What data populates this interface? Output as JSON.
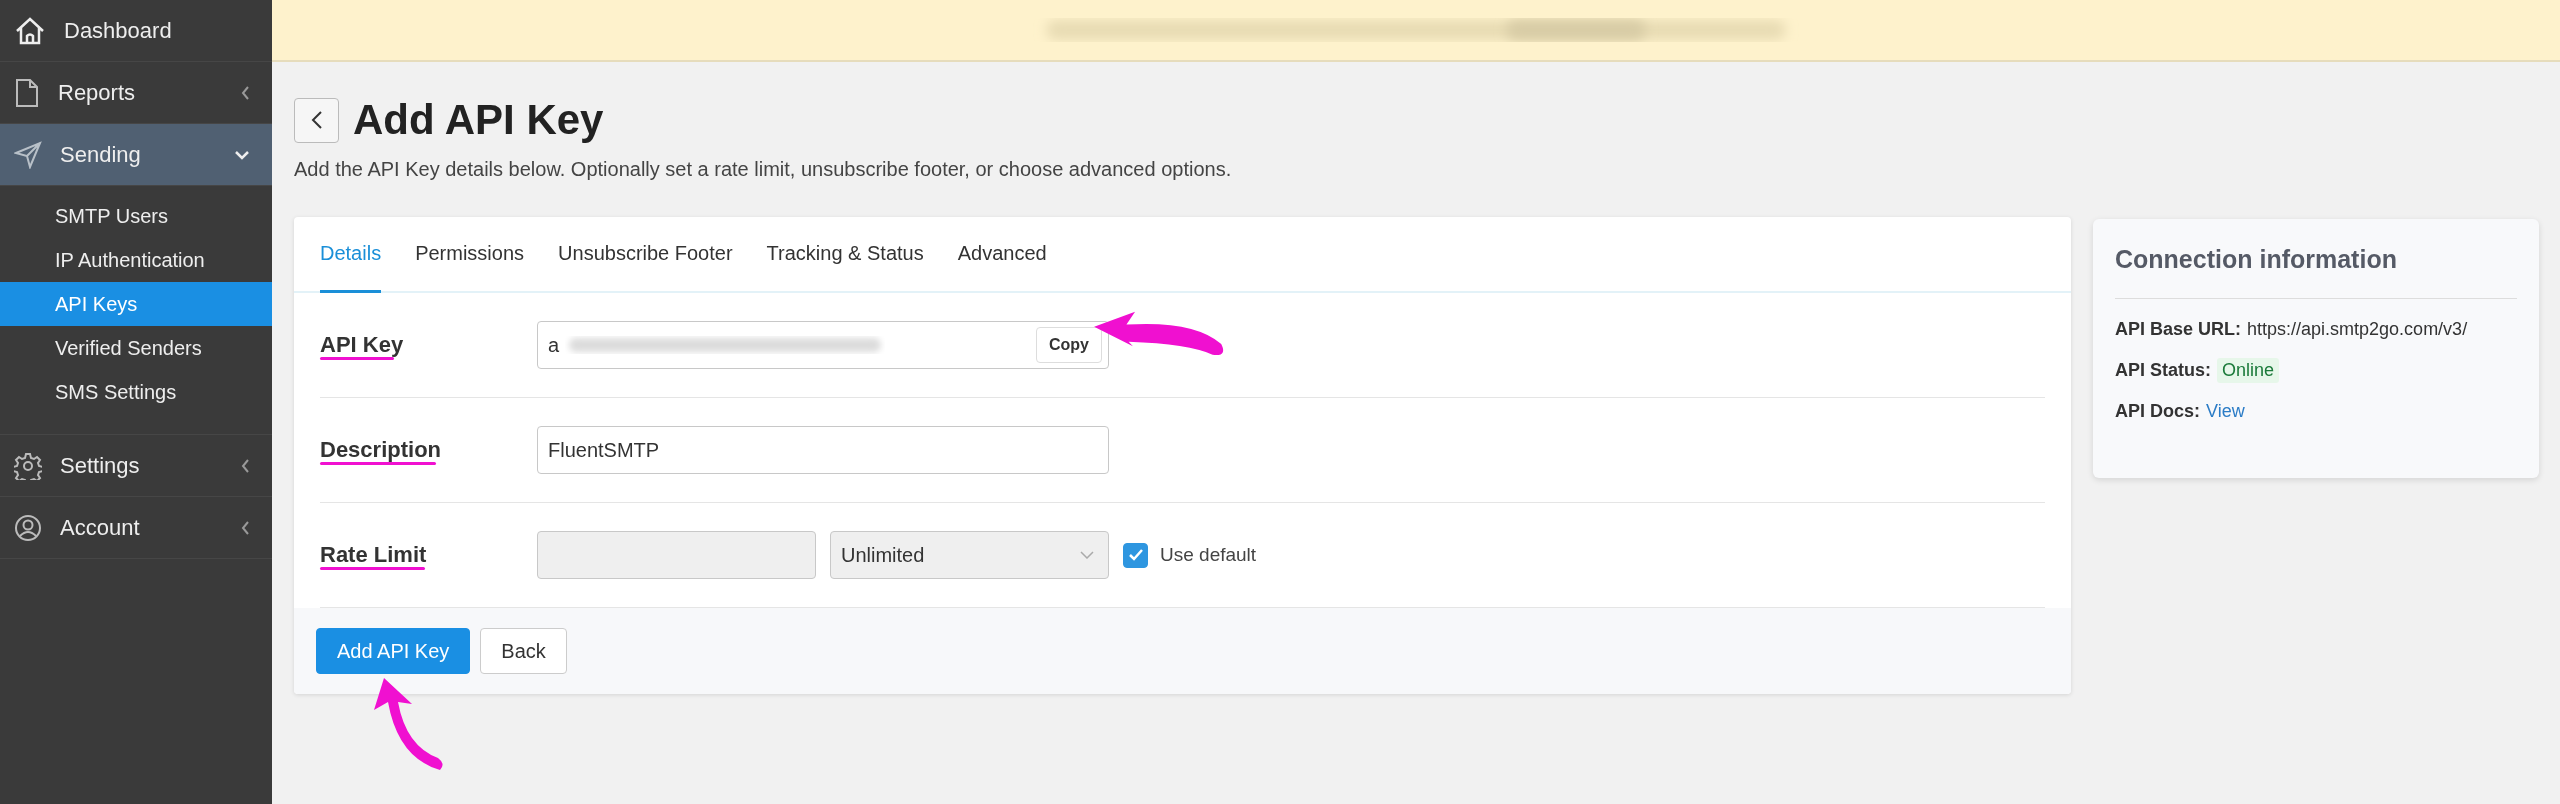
{
  "sidebar": {
    "items": [
      {
        "label": "Dashboard",
        "selected": false
      },
      {
        "label": "Reports",
        "expanded": false,
        "selected": false
      },
      {
        "label": "Sending",
        "expanded": true,
        "selected": true,
        "children": [
          {
            "label": "SMTP Users",
            "selected": false
          },
          {
            "label": "IP Authentication",
            "selected": false
          },
          {
            "label": "API Keys",
            "selected": true
          },
          {
            "label": "Verified Senders",
            "selected": false
          },
          {
            "label": "SMS Settings",
            "selected": false
          }
        ]
      },
      {
        "label": "Settings",
        "expanded": false,
        "selected": false
      },
      {
        "label": "Account",
        "expanded": false,
        "selected": false
      }
    ]
  },
  "banner": {
    "kind": "blurred"
  },
  "header": {
    "title": "Add API Key",
    "subtitle": "Add the API Key details below. Optionally set a rate limit, unsubscribe footer, or choose advanced options."
  },
  "tabs": [
    {
      "label": "Details",
      "selected": true
    },
    {
      "label": "Permissions",
      "selected": false
    },
    {
      "label": "Unsubscribe Footer",
      "selected": false
    },
    {
      "label": "Tracking & Status",
      "selected": false
    },
    {
      "label": "Advanced",
      "selected": false
    }
  ],
  "form": {
    "rows": [
      {
        "kind": "secret",
        "label": "API Key",
        "value": "a",
        "button": "Copy",
        "underlined": true,
        "pointed": true
      },
      {
        "kind": "text",
        "label": "Description",
        "value": "FluentSMTP",
        "underlined": true,
        "pointed": false
      },
      {
        "kind": "rate",
        "label": "Rate Limit",
        "value": "",
        "select": "Unlimited",
        "disabled": true,
        "checkbox": {
          "label": "Use default",
          "checked": true
        },
        "underlined": true,
        "pointed": false
      }
    ]
  },
  "actions": [
    {
      "label": "Add API Key",
      "primary": true,
      "pointed": true
    },
    {
      "label": "Back",
      "primary": false,
      "pointed": false
    }
  ],
  "connection": {
    "title": "Connection information",
    "lines": [
      {
        "kind": "text",
        "label": "API Base URL:",
        "value": "https://api.smtp2go.com/v3/"
      },
      {
        "kind": "badge",
        "label": "API Status:",
        "value": "Online"
      },
      {
        "kind": "link",
        "label": "API Docs:",
        "value": "View"
      }
    ]
  }
}
